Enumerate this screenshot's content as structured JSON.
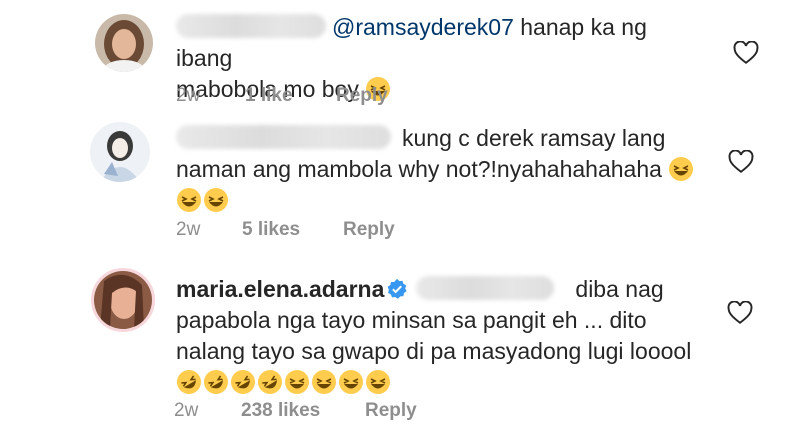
{
  "comments": [
    {
      "mention": "@ramsayderek07",
      "line1_text": " hanap ka ng ibang",
      "line2_text": "mabobola mo boy",
      "emojis_line2": [
        "laughing-emoji"
      ],
      "time": "2w",
      "likes": "1 like",
      "reply": "Reply"
    },
    {
      "line1_text": "kung c derek ramsay lang",
      "line2_text": "naman ang mambola why not?!nyahahahahaha",
      "emojis_line2": [
        "laughing-emoji"
      ],
      "emojis_line3": [
        "laughing-emoji",
        "laughing-emoji"
      ],
      "time": "2w",
      "likes": "5 likes",
      "reply": "Reply"
    },
    {
      "username": "maria.elena.adarna",
      "line1_text": "diba nag",
      "line2_text": "papabola nga tayo minsan sa pangit eh ... dito",
      "line3_text": "nalang tayo sa gwapo di pa masyadong lugi looool",
      "emojis_line4": [
        "rofl-emoji",
        "rofl-emoji",
        "rofl-emoji",
        "rofl-emoji",
        "laughing-emoji",
        "laughing-emoji",
        "laughing-emoji",
        "laughing-emoji"
      ],
      "time": "2w",
      "likes": "238 likes",
      "reply": "Reply"
    }
  ],
  "colors": {
    "text": "#262626",
    "meta": "#8e8e8e",
    "mention": "#00376b",
    "verified": "#3897f0"
  },
  "icons": {
    "like": "heart-outline-icon",
    "verified": "verified-badge-icon"
  }
}
